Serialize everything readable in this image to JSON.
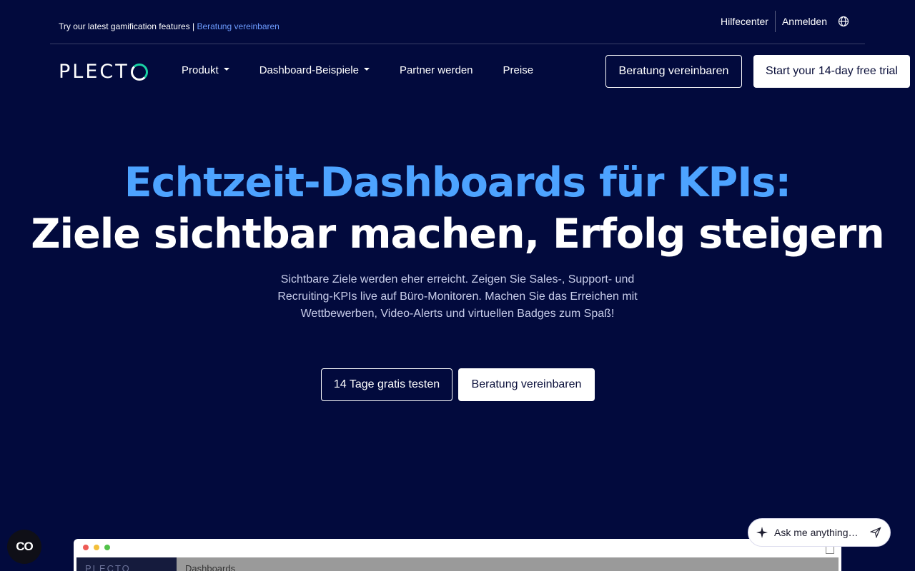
{
  "topbar": {
    "promo_text": "Try our latest gamification features |",
    "promo_link": "Beratung vereinbaren",
    "links": [
      "Hilfecenter",
      "Anmelden"
    ]
  },
  "nav": {
    "logo": "PLECT",
    "menu": [
      {
        "label": "Produkt",
        "dropdown": true
      },
      {
        "label": "Dashboard-Beispiele",
        "dropdown": true
      },
      {
        "label": "Partner werden",
        "dropdown": false
      },
      {
        "label": "Preise",
        "dropdown": false
      }
    ],
    "consult_button": "Beratung vereinbaren",
    "trial_button": "Start your 14-day free trial"
  },
  "hero": {
    "title_line1": "Echtzeit-Dashboards für KPIs:",
    "title_line2": "Ziele sichtbar machen, Erfolg steigern",
    "subtitle": "Sichtbare Ziele werden eher erreicht. Zeigen Sie Sales-, Support- und Recruiting-KPIs live auf Büro-Monitoren. Machen Sie das Erreichen mit Wettbewerben, Video-Alerts und virtuellen Badges zum Spaß!",
    "cta_trial": "14 Tage gratis testen",
    "cta_consult": "Beratung vereinbaren"
  },
  "preview": {
    "logo": "PLECTO",
    "title": "Dashboards"
  },
  "cookie_button": "CO",
  "chat": {
    "placeholder": "Ask me anything…"
  },
  "colors": {
    "background": "#020a3d",
    "accent": "#4da3ff",
    "logo_accent": "#19d3a4"
  }
}
